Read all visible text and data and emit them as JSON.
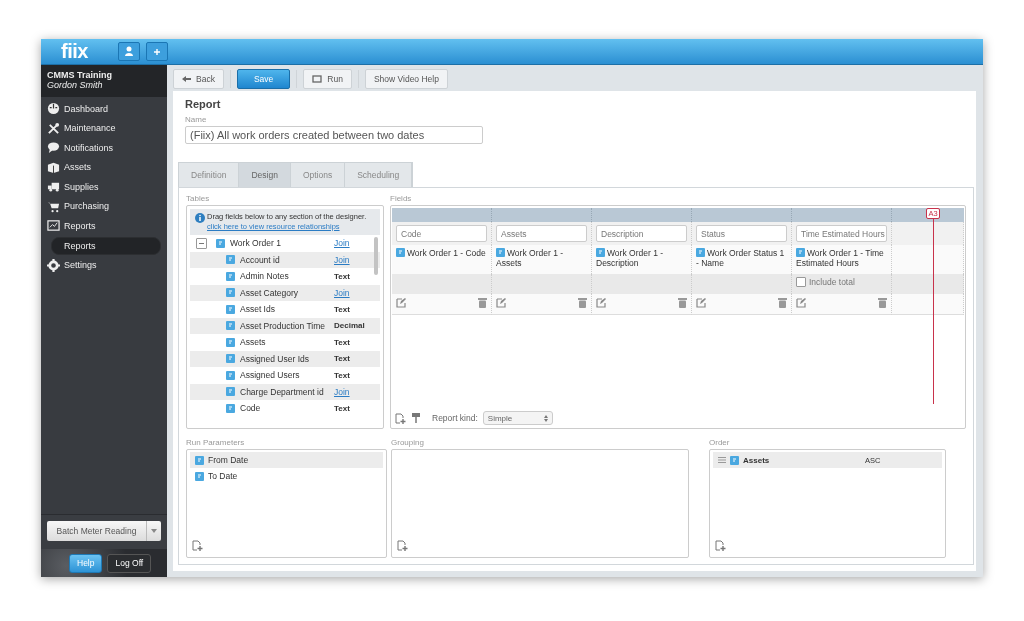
{
  "app": {
    "logo": "fiix"
  },
  "sidebar": {
    "company": "CMMS Training",
    "user": "Gordon Smith",
    "items": [
      {
        "label": "Dashboard",
        "selected": false
      },
      {
        "label": "Maintenance",
        "selected": false
      },
      {
        "label": "Notifications",
        "selected": false
      },
      {
        "label": "Assets",
        "selected": false
      },
      {
        "label": "Supplies",
        "selected": false
      },
      {
        "label": "Purchasing",
        "selected": false
      },
      {
        "label": "Reports",
        "selected": false,
        "children": [
          {
            "label": "Reports",
            "selected": true
          }
        ]
      },
      {
        "label": "Settings",
        "selected": false
      }
    ],
    "batch_button": "Batch Meter Reading",
    "footer_buttons": [
      {
        "label": "Help",
        "selected": true
      },
      {
        "label": "Log Off",
        "selected": false
      }
    ]
  },
  "toolbar": [
    {
      "label": "Back",
      "kind": "back"
    },
    {
      "label": "Save",
      "kind": "primary"
    },
    {
      "label": "Run",
      "kind": "run"
    },
    {
      "label": "Show Video Help",
      "kind": "plain"
    }
  ],
  "report": {
    "title": "Report",
    "name_label": "Name",
    "name_value": "(Fiix) All work orders created between two dates",
    "tabs": [
      {
        "label": "Definition",
        "selected": false
      },
      {
        "label": "Design",
        "selected": true
      },
      {
        "label": "Options",
        "selected": false
      },
      {
        "label": "Scheduling",
        "selected": false
      }
    ],
    "tables": {
      "heading": "Tables",
      "info": "Drag fields below to any section of the designer.",
      "link": "click here to view resource relationships",
      "tree": [
        {
          "label": "Work Order 1",
          "type": "Join",
          "kind": "link",
          "expanded": true,
          "children": [
            {
              "label": "Account id",
              "type": "Join",
              "kind": "link"
            },
            {
              "label": "Admin Notes",
              "type": "Text",
              "kind": "type"
            },
            {
              "label": "Asset Category",
              "type": "Join",
              "kind": "link"
            },
            {
              "label": "Asset Ids",
              "type": "Text",
              "kind": "type"
            },
            {
              "label": "Asset Production Time",
              "type": "Decimal",
              "kind": "type"
            },
            {
              "label": "Assets",
              "type": "Text",
              "kind": "type"
            },
            {
              "label": "Assigned User Ids",
              "type": "Text",
              "kind": "type"
            },
            {
              "label": "Assigned Users",
              "type": "Text",
              "kind": "type"
            },
            {
              "label": "Charge Department id",
              "type": "Join",
              "kind": "link"
            },
            {
              "label": "Code",
              "type": "Text",
              "kind": "type"
            }
          ]
        }
      ]
    },
    "fields": {
      "heading": "Fields",
      "marker": "A3",
      "columns": [
        {
          "header": "Code",
          "field": "Work Order 1 - Code"
        },
        {
          "header": "Assets",
          "field": "Work Order 1 - Assets"
        },
        {
          "header": "Description",
          "field": "Work Order 1 - Description"
        },
        {
          "header": "Status",
          "field": "Work Order Status 1 - Name"
        },
        {
          "header": "Time Estimated Hours",
          "field": "Work Order 1 - Time Estimated Hours",
          "total": {
            "label": "Include total",
            "checked": false
          }
        }
      ],
      "report_kind": {
        "label": "Report kind:",
        "value": "Simple"
      }
    },
    "run_parameters": {
      "heading": "Run Parameters",
      "items": [
        "From Date",
        "To Date"
      ]
    },
    "grouping": {
      "heading": "Grouping"
    },
    "order": {
      "heading": "Order",
      "items": [
        {
          "field": "Assets",
          "direction": "ASC"
        }
      ]
    }
  }
}
